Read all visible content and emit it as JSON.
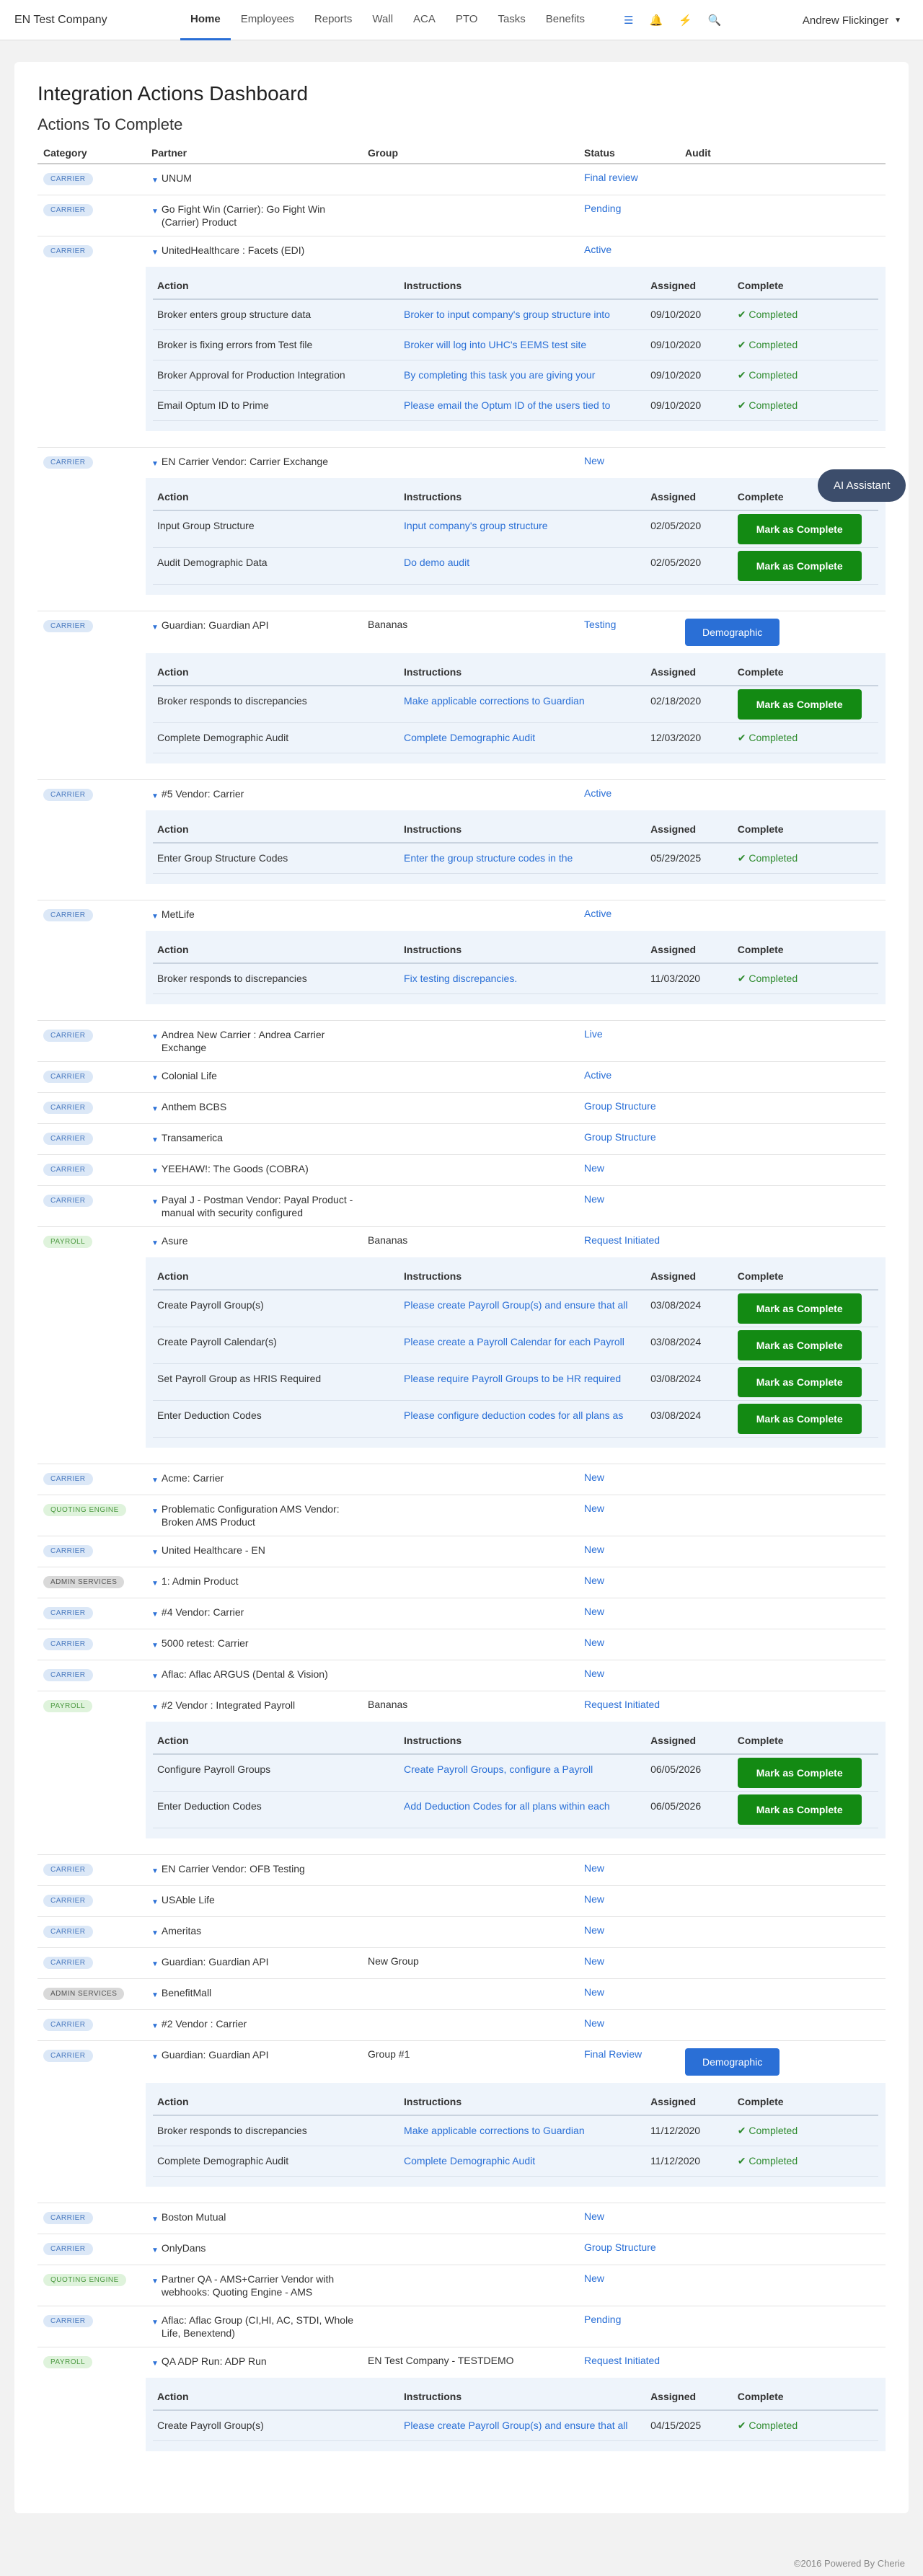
{
  "brand": "EN Test Company",
  "nav": [
    "Home",
    "Employees",
    "Reports",
    "Wall",
    "ACA",
    "PTO",
    "Tasks",
    "Benefits"
  ],
  "icons": [
    "list-icon",
    "bell-icon",
    "bolt-icon",
    "search-icon"
  ],
  "user": "Andrew Flickinger",
  "title": "Integration Actions Dashboard",
  "subtitle": "Actions To Complete",
  "headers": [
    "Category",
    "Partner",
    "Group",
    "Status",
    "Audit"
  ],
  "sub_headers": [
    "Action",
    "Instructions",
    "Assigned",
    "Complete"
  ],
  "completed_label": "Completed",
  "mark_label": "Mark as Complete",
  "ai_assistant": "AI Assistant",
  "footer": "©2016 Powered By Cherie",
  "rows": [
    {
      "cat": "CARRIER",
      "cls": "carrier",
      "partner": "UNUM",
      "group": "",
      "status": "Final review"
    },
    {
      "cat": "CARRIER",
      "cls": "carrier",
      "partner": "Go Fight Win (Carrier): Go Fight Win (Carrier) Product",
      "group": "",
      "status": "Pending"
    },
    {
      "cat": "CARRIER",
      "cls": "carrier",
      "partner": "UnitedHealthcare : Facets (EDI)",
      "group": "",
      "status": "Active",
      "actions": [
        {
          "a": "Broker enters group structure data",
          "i": "Broker to input company's group structure into",
          "d": "09/10/2020",
          "c": true
        },
        {
          "a": "Broker is fixing errors from Test file",
          "i": "Broker will log into UHC's EEMS test site",
          "d": "09/10/2020",
          "c": true
        },
        {
          "a": "Broker Approval for Production Integration",
          "i": "By completing this task you are giving your",
          "d": "09/10/2020",
          "c": true
        },
        {
          "a": "Email Optum ID to Prime",
          "i": "Please email the Optum ID of the users tied to",
          "d": "09/10/2020",
          "c": true
        }
      ]
    },
    {
      "cat": "CARRIER",
      "cls": "carrier",
      "partner": "EN Carrier Vendor: Carrier Exchange",
      "group": "",
      "status": "New",
      "actions": [
        {
          "a": "Input Group Structure",
          "i": "Input company's group structure",
          "d": "02/05/2020",
          "c": false
        },
        {
          "a": "Audit Demographic Data",
          "i": "Do demo audit",
          "d": "02/05/2020",
          "c": false
        }
      ]
    },
    {
      "cat": "CARRIER",
      "cls": "carrier",
      "partner": "Guardian: Guardian API",
      "group": "Bananas",
      "status": "Testing",
      "demo": "Demographic",
      "actions": [
        {
          "a": "Broker responds to discrepancies",
          "i": "Make applicable corrections to Guardian",
          "d": "02/18/2020",
          "c": false
        },
        {
          "a": "Complete Demographic Audit",
          "i": "Complete Demographic Audit",
          "d": "12/03/2020",
          "c": true
        }
      ]
    },
    {
      "cat": "CARRIER",
      "cls": "carrier",
      "partner": "#5 Vendor: Carrier",
      "group": "",
      "status": "Active",
      "actions": [
        {
          "a": "Enter Group Structure Codes",
          "i": "Enter the group structure codes in the",
          "d": "05/29/2025",
          "c": true
        }
      ]
    },
    {
      "cat": "CARRIER",
      "cls": "carrier",
      "partner": "MetLife",
      "group": "",
      "status": "Active",
      "actions": [
        {
          "a": "Broker responds to discrepancies",
          "i": "Fix testing discrepancies.",
          "d": "11/03/2020",
          "c": true
        }
      ]
    },
    {
      "cat": "CARRIER",
      "cls": "carrier",
      "partner": "Andrea New Carrier : Andrea Carrier Exchange",
      "group": "",
      "status": "Live"
    },
    {
      "cat": "CARRIER",
      "cls": "carrier",
      "partner": "Colonial Life",
      "group": "",
      "status": "Active"
    },
    {
      "cat": "CARRIER",
      "cls": "carrier",
      "partner": "Anthem BCBS",
      "group": "",
      "status": "Group Structure"
    },
    {
      "cat": "CARRIER",
      "cls": "carrier",
      "partner": "Transamerica",
      "group": "",
      "status": "Group Structure"
    },
    {
      "cat": "CARRIER",
      "cls": "carrier",
      "partner": "YEEHAW!: The Goods (COBRA)",
      "group": "",
      "status": "New"
    },
    {
      "cat": "CARRIER",
      "cls": "carrier",
      "partner": "Payal J - Postman Vendor: Payal Product - manual with security configured",
      "group": "",
      "status": "New"
    },
    {
      "cat": "PAYROLL",
      "cls": "payroll",
      "partner": "Asure",
      "group": "Bananas",
      "status": "Request Initiated",
      "actions": [
        {
          "a": "Create Payroll Group(s)",
          "i": "Please create Payroll Group(s) and ensure that all",
          "d": "03/08/2024",
          "c": false
        },
        {
          "a": "Create Payroll Calendar(s)",
          "i": "Please create a Payroll Calendar for each Payroll",
          "d": "03/08/2024",
          "c": false
        },
        {
          "a": "Set Payroll Group as HRIS Required",
          "i": "Please require Payroll Groups to be HR required",
          "d": "03/08/2024",
          "c": false
        },
        {
          "a": "Enter Deduction Codes",
          "i": "Please configure deduction codes for all plans as",
          "d": "03/08/2024",
          "c": false
        }
      ]
    },
    {
      "cat": "CARRIER",
      "cls": "carrier",
      "partner": "Acme: Carrier",
      "group": "",
      "status": "New"
    },
    {
      "cat": "QUOTING ENGINE",
      "cls": "quoting",
      "partner": "Problematic Configuration AMS Vendor: Broken AMS Product",
      "group": "",
      "status": "New"
    },
    {
      "cat": "CARRIER",
      "cls": "carrier",
      "partner": "United Healthcare - EN",
      "group": "",
      "status": "New"
    },
    {
      "cat": "ADMIN SERVICES",
      "cls": "admin",
      "partner": "1: Admin Product",
      "group": "",
      "status": "New"
    },
    {
      "cat": "CARRIER",
      "cls": "carrier",
      "partner": "#4 Vendor: Carrier",
      "group": "",
      "status": "New"
    },
    {
      "cat": "CARRIER",
      "cls": "carrier",
      "partner": "5000 retest: Carrier",
      "group": "",
      "status": "New"
    },
    {
      "cat": "CARRIER",
      "cls": "carrier",
      "partner": "Aflac: Aflac ARGUS (Dental & Vision)",
      "group": "",
      "status": "New"
    },
    {
      "cat": "PAYROLL",
      "cls": "payroll",
      "partner": "#2 Vendor : Integrated Payroll",
      "group": "Bananas",
      "status": "Request Initiated",
      "actions": [
        {
          "a": "Configure Payroll Groups",
          "i": "Create Payroll Groups, configure a Payroll",
          "d": "06/05/2026",
          "c": false
        },
        {
          "a": "Enter Deduction Codes",
          "i": "Add Deduction Codes for all plans within each",
          "d": "06/05/2026",
          "c": false
        }
      ]
    },
    {
      "cat": "CARRIER",
      "cls": "carrier",
      "partner": "EN Carrier Vendor: OFB Testing",
      "group": "",
      "status": "New"
    },
    {
      "cat": "CARRIER",
      "cls": "carrier",
      "partner": "USAble Life",
      "group": "",
      "status": "New"
    },
    {
      "cat": "CARRIER",
      "cls": "carrier",
      "partner": "Ameritas",
      "group": "",
      "status": "New"
    },
    {
      "cat": "CARRIER",
      "cls": "carrier",
      "partner": "Guardian: Guardian API",
      "group": "New Group",
      "status": "New"
    },
    {
      "cat": "ADMIN SERVICES",
      "cls": "admin",
      "partner": "BenefitMall",
      "group": "",
      "status": "New"
    },
    {
      "cat": "CARRIER",
      "cls": "carrier",
      "partner": "#2 Vendor : Carrier",
      "group": "",
      "status": "New"
    },
    {
      "cat": "CARRIER",
      "cls": "carrier",
      "partner": "Guardian: Guardian API",
      "group": "Group #1",
      "status": "Final Review",
      "demo": "Demographic",
      "actions": [
        {
          "a": "Broker responds to discrepancies",
          "i": "Make applicable corrections to Guardian",
          "d": "11/12/2020",
          "c": true
        },
        {
          "a": "Complete Demographic Audit",
          "i": "Complete Demographic Audit",
          "d": "11/12/2020",
          "c": true
        }
      ]
    },
    {
      "cat": "CARRIER",
      "cls": "carrier",
      "partner": "Boston Mutual",
      "group": "",
      "status": "New"
    },
    {
      "cat": "CARRIER",
      "cls": "carrier",
      "partner": "OnlyDans",
      "group": "",
      "status": "Group Structure"
    },
    {
      "cat": "QUOTING ENGINE",
      "cls": "quoting",
      "partner": "Partner QA - AMS+Carrier Vendor with webhooks: Quoting Engine - AMS",
      "group": "",
      "status": "New"
    },
    {
      "cat": "CARRIER",
      "cls": "carrier",
      "partner": "Aflac: Aflac Group (CI,HI, AC, STDI, Whole Life, Benextend)",
      "group": "",
      "status": "Pending"
    },
    {
      "cat": "PAYROLL",
      "cls": "payroll",
      "partner": "QA ADP Run: ADP Run",
      "group": "EN Test Company - TESTDEMO",
      "status": "Request Initiated",
      "actions": [
        {
          "a": "Create Payroll Group(s)",
          "i": "Please create Payroll Group(s) and ensure that all",
          "d": "04/15/2025",
          "c": true
        }
      ]
    }
  ]
}
